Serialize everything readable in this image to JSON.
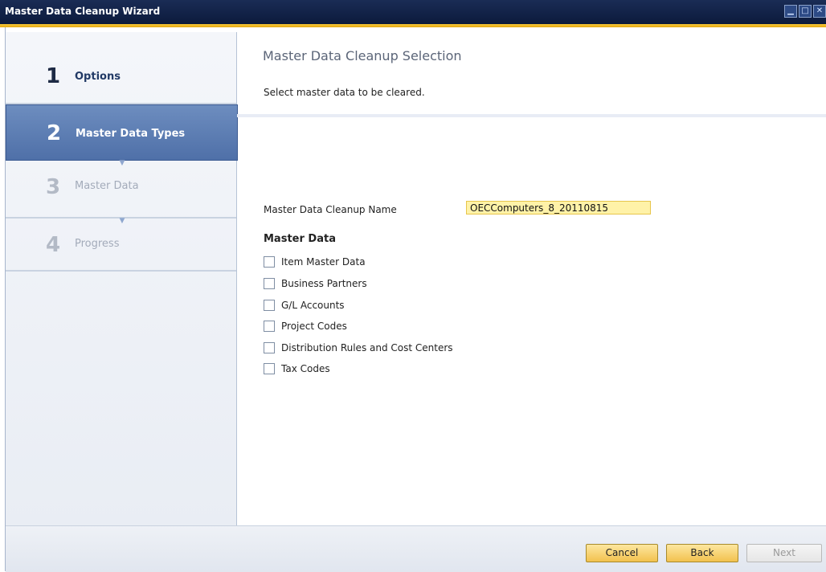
{
  "window": {
    "title": "Master Data Cleanup Wizard",
    "controls": [
      "minimize-icon",
      "maximize-icon",
      "close-icon"
    ]
  },
  "sidebar": {
    "steps": [
      {
        "number": "1",
        "label": "Options",
        "state": "done"
      },
      {
        "number": "2",
        "label": "Master Data Types",
        "state": "active"
      },
      {
        "number": "3",
        "label": "Master Data",
        "state": "disabled"
      },
      {
        "number": "4",
        "label": "Progress",
        "state": "disabled"
      }
    ]
  },
  "main": {
    "title": "Master Data Cleanup Selection",
    "subtitle": "Select master data to be cleared.",
    "name_label": "Master Data Cleanup Name",
    "name_value": "OECComputers_8_20110815",
    "section_title": "Master Data",
    "options": [
      {
        "label": "Item Master Data",
        "checked": false
      },
      {
        "label": "Business Partners",
        "checked": false
      },
      {
        "label": "G/L Accounts",
        "checked": false
      },
      {
        "label": "Project Codes",
        "checked": false
      },
      {
        "label": "Distribution Rules and Cost Centers",
        "checked": false
      },
      {
        "label": "Tax Codes",
        "checked": false
      }
    ]
  },
  "footer": {
    "cancel_label": "Cancel",
    "back_label": "Back",
    "next_label": "Next"
  },
  "colors": {
    "accent": "#f2c14e",
    "active_step": "#5b7ab2",
    "input_bg": "#fff2a8"
  }
}
